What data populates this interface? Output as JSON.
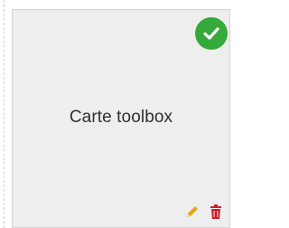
{
  "card": {
    "title": "Carte toolbox",
    "status": "check-icon",
    "status_color": "#35a93a",
    "edit_icon": "pencil-icon",
    "edit_color": "#e8a21b",
    "delete_icon": "trash-icon",
    "delete_color": "#c91f26"
  }
}
